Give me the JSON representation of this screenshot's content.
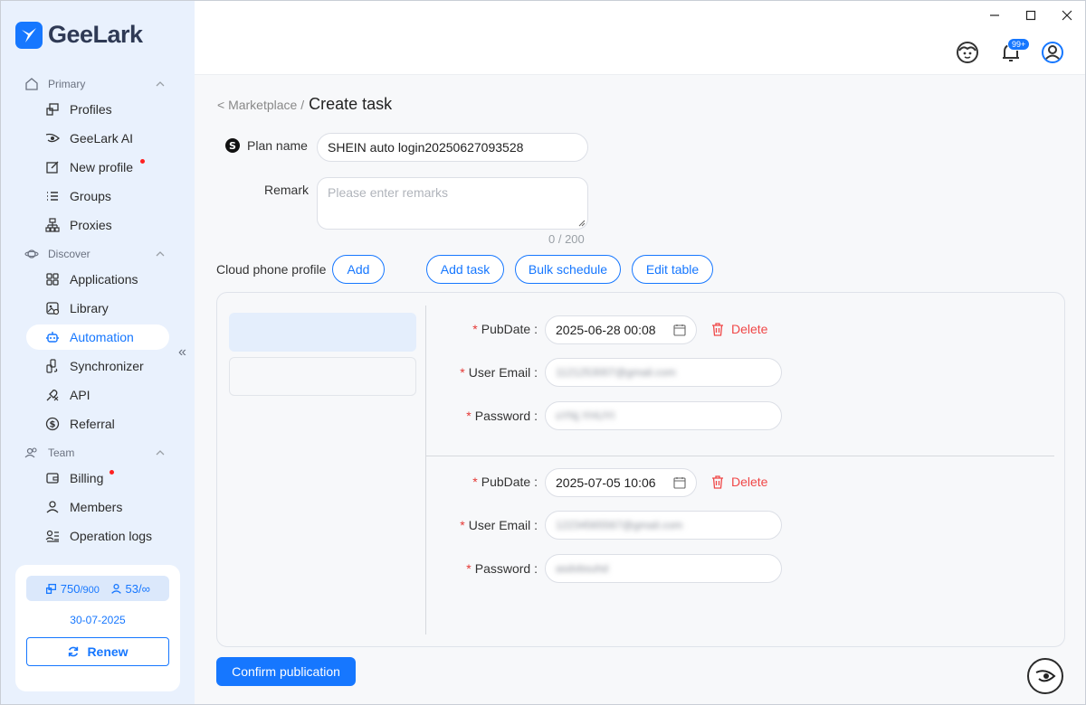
{
  "app": {
    "name": "GeeLark"
  },
  "sidebar": {
    "sections": [
      {
        "label": "Primary",
        "icon": "home-icon"
      },
      {
        "label": "Discover",
        "icon": "planet-icon"
      },
      {
        "label": "Team",
        "icon": "team-icon"
      }
    ],
    "items": [
      {
        "label": "Profiles",
        "icon": "profiles-icon"
      },
      {
        "label": "GeeLark AI",
        "icon": "ai-eye-icon"
      },
      {
        "label": "New profile",
        "icon": "edit-icon"
      },
      {
        "label": "Groups",
        "icon": "list-icon"
      },
      {
        "label": "Proxies",
        "icon": "proxy-icon"
      },
      {
        "label": "Applications",
        "icon": "grid-icon"
      },
      {
        "label": "Library",
        "icon": "library-icon"
      },
      {
        "label": "Automation",
        "icon": "robot-icon"
      },
      {
        "label": "Synchronizer",
        "icon": "sync-icon"
      },
      {
        "label": "API",
        "icon": "api-icon"
      },
      {
        "label": "Referral",
        "icon": "dollar-icon"
      },
      {
        "label": "Billing",
        "icon": "wallet-icon"
      },
      {
        "label": "Members",
        "icon": "user-icon"
      },
      {
        "label": "Operation logs",
        "icon": "logs-icon"
      }
    ],
    "active_item": "Automation",
    "account": {
      "profiles_used": "750",
      "profiles_total": "/900",
      "members_used": "53",
      "members_total": "/∞",
      "expiry": "30-07-2025",
      "renew_label": "Renew"
    }
  },
  "topbar": {
    "notification_badge": "99+"
  },
  "breadcrumb": {
    "parent": "< Marketplace /",
    "current": "Create task"
  },
  "form": {
    "plan_name_label": "Plan name",
    "plan_name_value": "SHEIN auto login20250627093528",
    "remark_label": "Remark",
    "remark_placeholder": "Please enter remarks",
    "remark_counter": "0 / 200",
    "cloud_profile_label": "Cloud phone profile",
    "add_label": "Add",
    "add_task_label": "Add task",
    "bulk_schedule_label": "Bulk schedule",
    "edit_table_label": "Edit table"
  },
  "tasks": [
    {
      "pubdate_label": "PubDate",
      "pubdate": "2025-06-28 00:08",
      "email_label": "User Email",
      "email": "1121253007@gmail.com",
      "password_label": "Password",
      "password": "sYNj.YHUYI",
      "delete_label": "Delete"
    },
    {
      "pubdate_label": "PubDate",
      "pubdate": "2025-07-05 10:06",
      "email_label": "User Email",
      "email": "12234565567@gmail.com",
      "password_label": "Password",
      "password": "asdvbsuhd",
      "delete_label": "Delete"
    }
  ],
  "confirm_label": "Confirm publication",
  "colors": {
    "accent": "#1677ff",
    "danger": "#f04747",
    "sidebar_bg": "#e9f1fd"
  }
}
